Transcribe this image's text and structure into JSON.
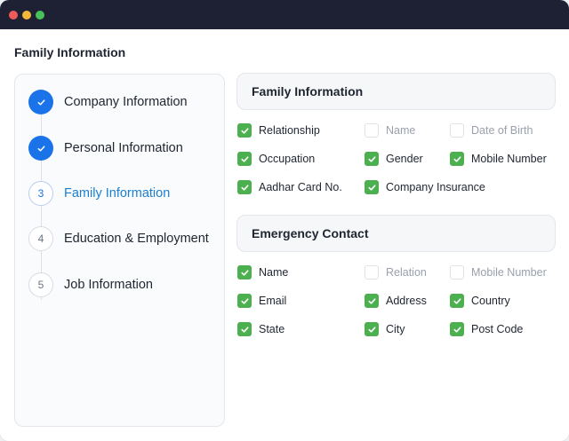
{
  "page": {
    "title": "Family Information"
  },
  "steps": [
    {
      "number": "1",
      "label": "Company Information",
      "state": "done"
    },
    {
      "number": "2",
      "label": "Personal Information",
      "state": "done"
    },
    {
      "number": "3",
      "label": "Family Information",
      "state": "active"
    },
    {
      "number": "4",
      "label": "Education & Employment",
      "state": "todo"
    },
    {
      "number": "5",
      "label": "Job Information",
      "state": "todo"
    }
  ],
  "family_section": {
    "title": "Family Information",
    "options": [
      {
        "label": "Relationship",
        "checked": true
      },
      {
        "label": "Name",
        "checked": false
      },
      {
        "label": "Date of Birth",
        "checked": false
      },
      {
        "label": "Occupation",
        "checked": true
      },
      {
        "label": "Gender",
        "checked": true
      },
      {
        "label": "Mobile Number",
        "checked": true
      },
      {
        "label": "Aadhar Card No.",
        "checked": true
      },
      {
        "label": "Company Insurance",
        "checked": true
      }
    ]
  },
  "emergency_section": {
    "title": "Emergency Contact",
    "options": [
      {
        "label": "Name",
        "checked": true
      },
      {
        "label": "Relation",
        "checked": false
      },
      {
        "label": "Mobile Number",
        "checked": false
      },
      {
        "label": "Email",
        "checked": true
      },
      {
        "label": "Address",
        "checked": true
      },
      {
        "label": "Country",
        "checked": true
      },
      {
        "label": "State",
        "checked": true
      },
      {
        "label": "City",
        "checked": true
      },
      {
        "label": "Post Code",
        "checked": true
      }
    ]
  },
  "colors": {
    "accent": "#1a73e8",
    "check": "#4caf50",
    "titlebar": "#1e2133"
  }
}
